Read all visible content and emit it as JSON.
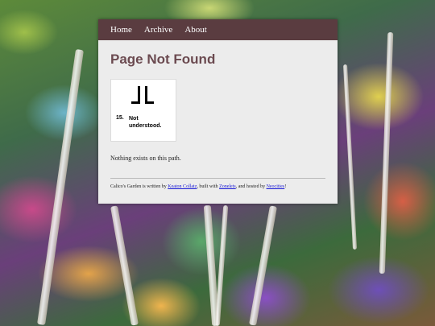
{
  "nav": {
    "home": "Home",
    "archive": "Archive",
    "about": "About"
  },
  "page": {
    "title": "Page Not Found",
    "message": "Nothing exists on this path."
  },
  "image": {
    "number": "15.",
    "caption_line1": "Not",
    "caption_line2": "understood."
  },
  "footer": {
    "text1": "Calico's Garden is written by ",
    "author": "Keaton Collatz",
    "text2": ", built with ",
    "builder": "Zonelets",
    "text3": ", and hosted by ",
    "host": "Neocities",
    "text4": "!"
  },
  "colors": {
    "navbar": "#5a3c40",
    "title": "#6b4a50",
    "panel": "#ececec",
    "link": "#1a1ad6"
  }
}
